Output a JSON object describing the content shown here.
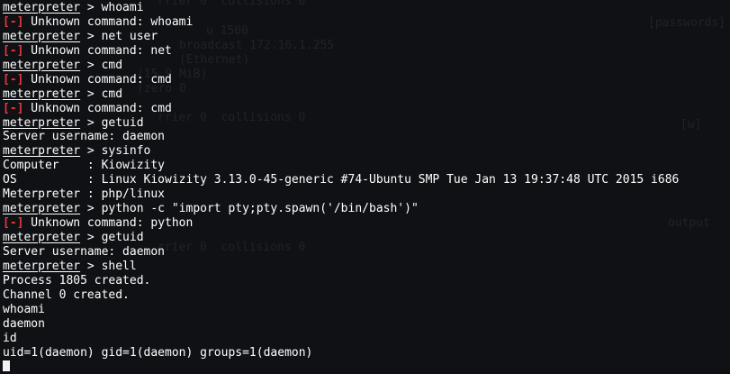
{
  "theme": {
    "background": "#0f1114",
    "text": "#ffffff",
    "error": "#e5383b",
    "ghost_text": "#3a3f47"
  },
  "background_ghost": [
    "rrier 0  collisions 0",
    "u 1500",
    "broadcast 172.16.1.255",
    "(Ethernet)",
    "(15.9 MiB)",
    "(zero 0",
    "rrier 0  collisions 0",
    "rrier 0  collisions 0",
    "[passwords]",
    "[w]",
    "output"
  ],
  "terminal": {
    "prompt": "meterpreter",
    "error_tag": "[-]",
    "lines": [
      {
        "type": "cmd",
        "text": " > whoami"
      },
      {
        "type": "err",
        "text": " Unknown command: whoami"
      },
      {
        "type": "cmd",
        "text": " > net user"
      },
      {
        "type": "err",
        "text": " Unknown command: net"
      },
      {
        "type": "cmd",
        "text": " > cmd"
      },
      {
        "type": "err",
        "text": " Unknown command: cmd"
      },
      {
        "type": "cmd",
        "text": " > cmd"
      },
      {
        "type": "err",
        "text": " Unknown command: cmd"
      },
      {
        "type": "cmd",
        "text": " > getuid"
      },
      {
        "type": "out",
        "text": "Server username: daemon"
      },
      {
        "type": "cmd",
        "text": " > sysinfo"
      },
      {
        "type": "out",
        "text": "Computer    : Kiowizity"
      },
      {
        "type": "out",
        "text": "OS          : Linux Kiowizity 3.13.0-45-generic #74-Ubuntu SMP Tue Jan 13 19:37:48 UTC 2015 i686"
      },
      {
        "type": "out",
        "text": "Meterpreter : php/linux"
      },
      {
        "type": "cmd",
        "text": " > python -c \"import pty;pty.spawn('/bin/bash')\""
      },
      {
        "type": "err",
        "text": " Unknown command: python"
      },
      {
        "type": "cmd",
        "text": " > getuid"
      },
      {
        "type": "out",
        "text": "Server username: daemon"
      },
      {
        "type": "cmd",
        "text": " > shell"
      },
      {
        "type": "out",
        "text": "Process 1805 created."
      },
      {
        "type": "out",
        "text": "Channel 0 created."
      },
      {
        "type": "out",
        "text": "whoami"
      },
      {
        "type": "out",
        "text": "daemon"
      },
      {
        "type": "out",
        "text": "id"
      },
      {
        "type": "out",
        "text": "uid=1(daemon) gid=1(daemon) groups=1(daemon)"
      },
      {
        "type": "cursor",
        "text": ""
      }
    ]
  }
}
